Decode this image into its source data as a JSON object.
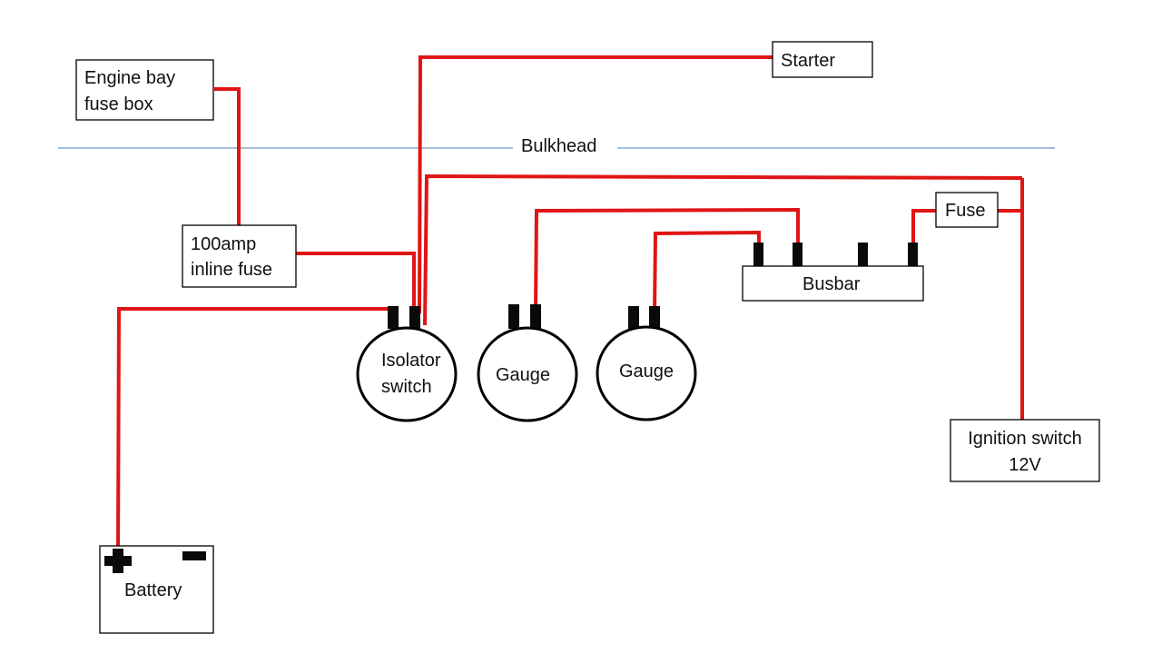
{
  "labels": {
    "engine_bay_fuse_box": [
      "Engine bay",
      "fuse box"
    ],
    "starter": "Starter",
    "bulkhead": "Bulkhead",
    "inline_fuse": [
      "100amp",
      "inline fuse"
    ],
    "isolator_switch": [
      "Isolator",
      "switch"
    ],
    "gauge_1": "Gauge",
    "gauge_2": "Gauge",
    "busbar": "Busbar",
    "fuse": "Fuse",
    "ignition_switch": [
      "Ignition switch",
      "12V"
    ],
    "battery": "Battery"
  },
  "colors": {
    "wire": "#e01515",
    "bulkhead_line": "#4a7fb0",
    "terminal": "#0a0a0a"
  }
}
